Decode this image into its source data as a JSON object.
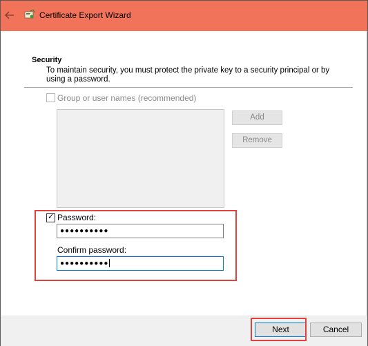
{
  "titlebar": {
    "title": "Certificate Export Wizard",
    "color": "#f0735a"
  },
  "icons": {
    "back": "back-arrow-icon",
    "app": "certificate-icon"
  },
  "security": {
    "title": "Security",
    "description": "To maintain security, you must protect the private key to a security principal or by using a password."
  },
  "group": {
    "label": "Group or user names (recommended)",
    "checked": false,
    "add_label": "Add",
    "remove_label": "Remove"
  },
  "password": {
    "label": "Password:",
    "checked": true,
    "value": "●●●●●●●●●●",
    "confirm_label": "Confirm password:",
    "confirm_value": "●●●●●●●●●●"
  },
  "footer": {
    "next_label": "Next",
    "cancel_label": "Cancel"
  },
  "highlight_color": "#e1403d"
}
